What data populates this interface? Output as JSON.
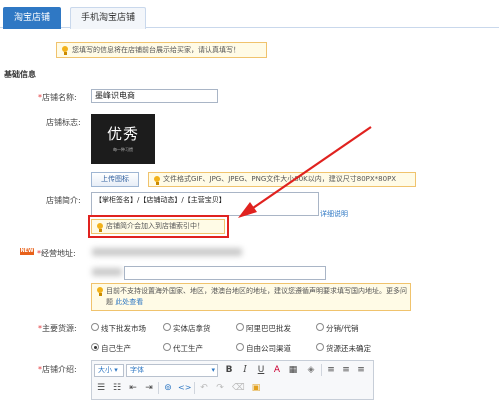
{
  "tabs": [
    {
      "label": "淘宝店铺"
    },
    {
      "label": "手机淘宝店铺"
    }
  ],
  "notice": "您填写的信息将在店铺前台展示给买家，请认真填写！",
  "section_title": "基础信息",
  "fields": {
    "shop_name": {
      "label": "店铺名称:",
      "value": "墨峰识电商"
    },
    "shop_logo": {
      "label": "店铺标志:",
      "logo_text": "优秀",
      "logo_sub": "每一种习惯",
      "upload_label": "上传图标",
      "tip": "文件格式GIF、JPG、JPEG、PNG文件大小80K以内，建议尺寸80PX*80PX"
    },
    "shop_intro": {
      "label": "店铺简介:",
      "value": "【掌柜签名】/【店铺动态】/【主营宝贝】",
      "detail_link": "详细说明",
      "tip": "店铺简介会加入到店铺索引中！"
    },
    "address": {
      "label": "经营地址:",
      "badge": "NEW",
      "tip": "目前不支持设置海外国家、地区，港澳台地区的地址，建议您遵循声明要求填写国内地址。更多问题",
      "tip_link": "此处查看"
    },
    "main_source": {
      "label": "主要货源:",
      "options": [
        "线下批发市场",
        "实体店拿货",
        "阿里巴巴批发",
        "分销/代销",
        "自己生产",
        "代工生产",
        "自由公司渠道",
        "货源还未确定"
      ],
      "selected": "自己生产"
    },
    "shop_desc": {
      "label": "店铺介绍:",
      "font_size": "大小",
      "font_family": "字体"
    }
  }
}
